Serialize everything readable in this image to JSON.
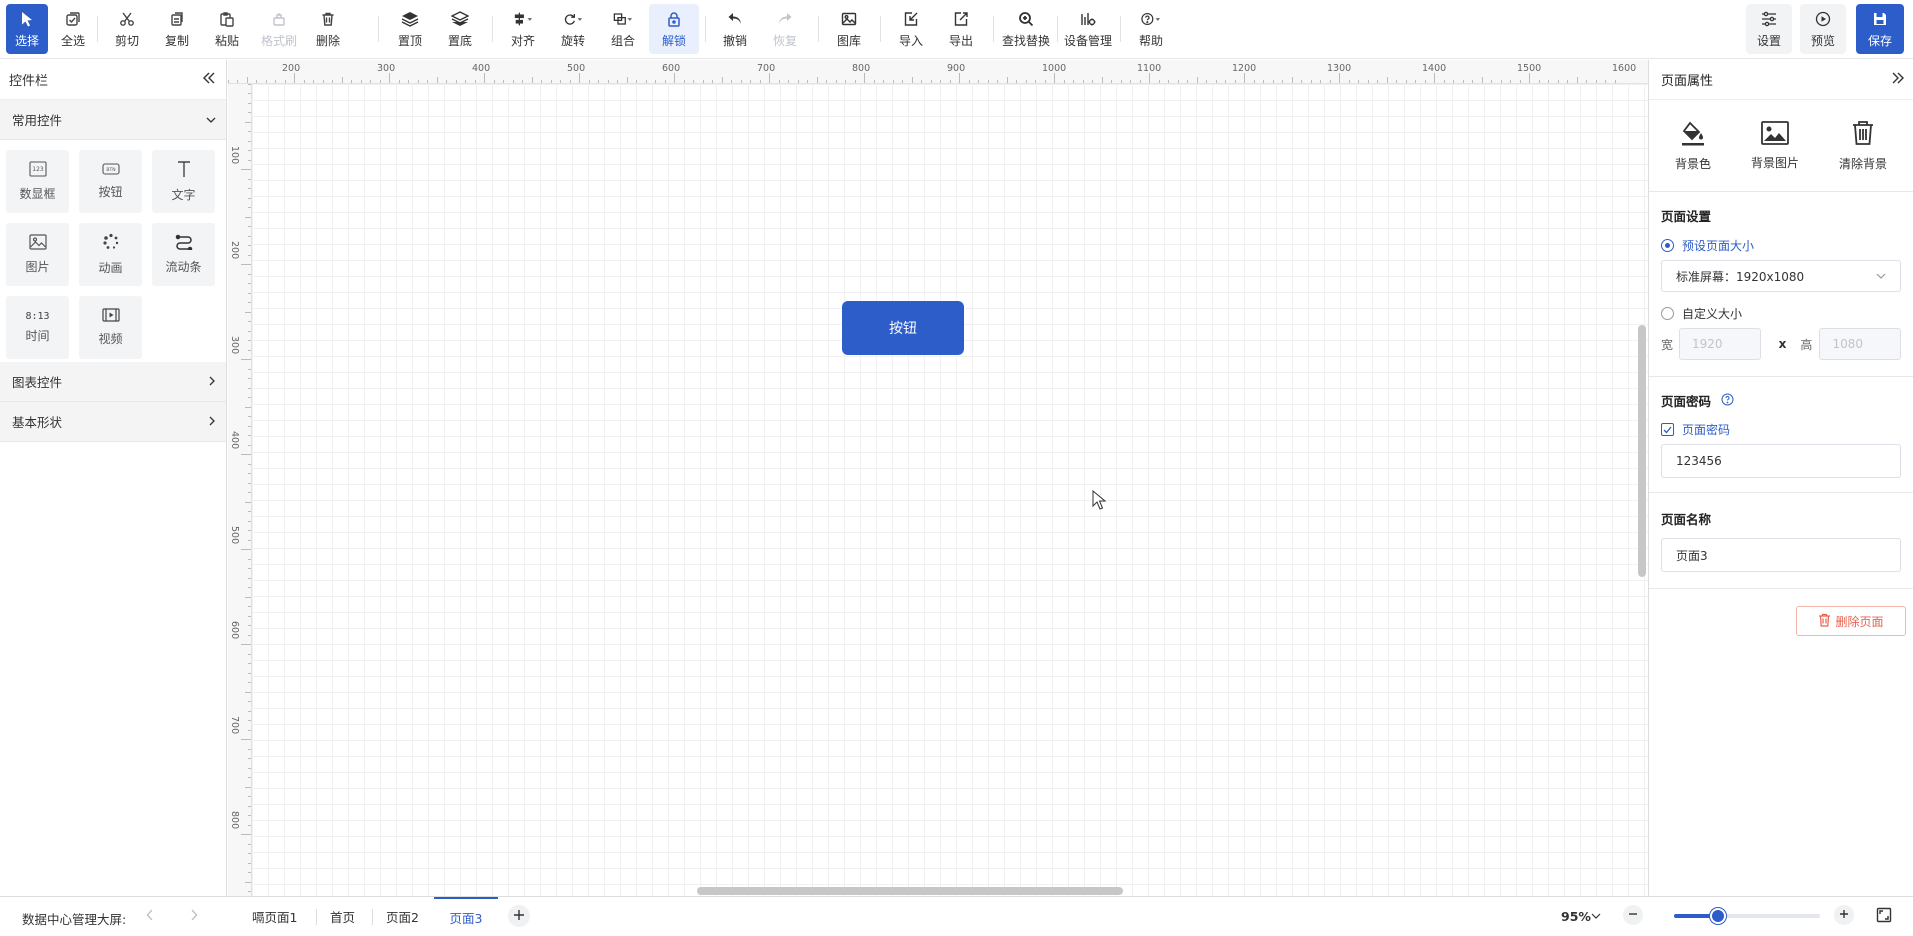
{
  "toolbar": {
    "select": "选择",
    "select_all": "全选",
    "cut": "剪切",
    "copy": "复制",
    "paste": "粘贴",
    "format_painter": "格式刷",
    "delete": "删除",
    "bring_top": "置顶",
    "send_bottom": "置底",
    "align": "对齐",
    "rotate": "旋转",
    "group": "组合",
    "unlock": "解锁",
    "undo": "撤销",
    "redo": "恢复",
    "gallery": "图库",
    "import": "导入",
    "export": "导出",
    "find_replace": "查找替换",
    "device_manage": "设备管理",
    "help": "帮助",
    "settings": "设置",
    "preview": "预览",
    "save": "保存"
  },
  "left_panel": {
    "title": "控件栏",
    "groups": {
      "common": "常用控件",
      "chart": "图表控件",
      "shapes": "基本形状"
    },
    "controls": [
      {
        "label": "数显框",
        "icon": "number-box-icon",
        "glyph": "123"
      },
      {
        "label": "按钮",
        "icon": "button-icon",
        "glyph": "BTN"
      },
      {
        "label": "文字",
        "icon": "text-icon",
        "glyph": "T"
      },
      {
        "label": "图片",
        "icon": "image-icon",
        "glyph": ""
      },
      {
        "label": "动画",
        "icon": "animation-icon",
        "glyph": ""
      },
      {
        "label": "流动条",
        "icon": "flow-bar-icon",
        "glyph": ""
      },
      {
        "label": "时间",
        "icon": "time-icon",
        "glyph": "8:13"
      },
      {
        "label": "视频",
        "icon": "video-icon",
        "glyph": ""
      }
    ]
  },
  "ruler": {
    "top": [
      "200",
      "300",
      "400",
      "500",
      "600",
      "700",
      "800",
      "900",
      "1000",
      "1100",
      "1200",
      "1300",
      "1400",
      "1500",
      "1600"
    ],
    "left": [
      "100",
      "200",
      "300",
      "400",
      "500",
      "600",
      "700",
      "800"
    ]
  },
  "canvas": {
    "button_label": "按钮"
  },
  "right_panel": {
    "title": "页面属性",
    "bg_color": "背景色",
    "bg_image": "背景图片",
    "clear_bg": "清除背景",
    "page_settings": "页面设置",
    "preset_size": "预设页面大小",
    "preset_value": "标准屏幕：1920x1080",
    "custom_size": "自定义大小",
    "width_label": "宽",
    "width_value": "1920",
    "x_label": "x",
    "height_label": "高",
    "height_value": "1080",
    "password_title": "页面密码",
    "password_checkbox": "页面密码",
    "password_value": "123456",
    "name_title": "页面名称",
    "name_value": "页面3",
    "delete_page": "删除页面"
  },
  "bottom": {
    "project_name": "数据中心管理大屏:",
    "tabs": [
      "嗝页面1",
      "首页",
      "页面2",
      "页面3"
    ],
    "active_tab": 3,
    "zoom": "95%",
    "zoom_fraction": 0.3
  },
  "colors": {
    "primary": "#2d5dc8",
    "danger": "#e8614f"
  }
}
